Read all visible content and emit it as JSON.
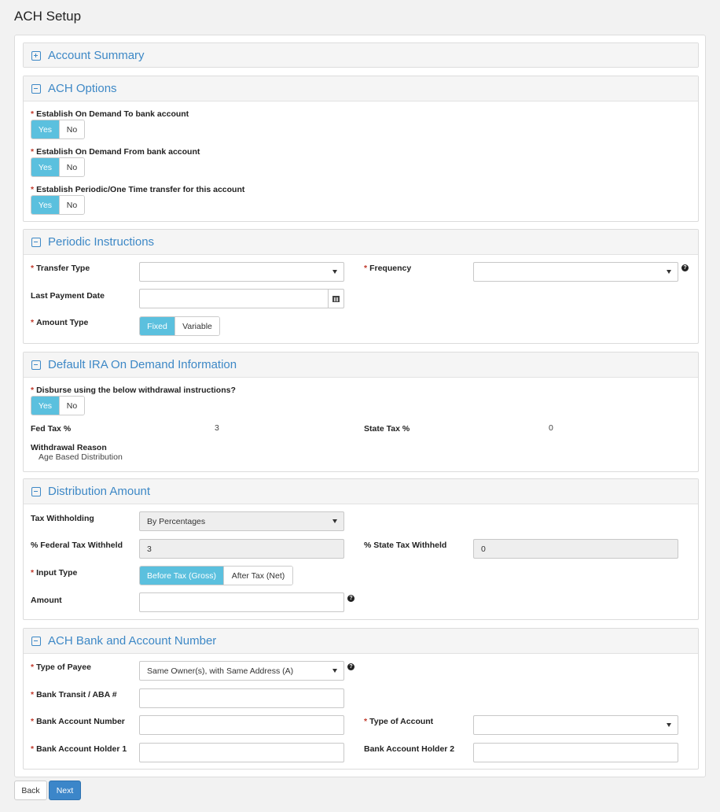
{
  "page_title": "ACH Setup",
  "colors": {
    "accent": "#3d88c6",
    "toggle_active": "#5bc0de",
    "required": "#c0392b",
    "primary_button": "#3c86c9"
  },
  "account_summary": {
    "title": "Account Summary",
    "icon": "plus-square-icon"
  },
  "ach_options": {
    "title": "ACH Options",
    "icon": "minus-square-icon",
    "q1": {
      "label": "Establish On Demand To bank account",
      "yes": "Yes",
      "no": "No",
      "selected": "Yes"
    },
    "q2": {
      "label": "Establish On Demand From bank account",
      "yes": "Yes",
      "no": "No",
      "selected": "Yes"
    },
    "q3": {
      "label": "Establish Periodic/One Time transfer for this account",
      "yes": "Yes",
      "no": "No",
      "selected": "Yes"
    }
  },
  "periodic": {
    "title": "Periodic Instructions",
    "transfer_type_label": "Transfer Type",
    "transfer_type_value": "",
    "frequency_label": "Frequency",
    "frequency_value": "",
    "last_payment_label": "Last Payment Date",
    "last_payment_value": "",
    "amount_type_label": "Amount Type",
    "amount_type_fixed": "Fixed",
    "amount_type_variable": "Variable",
    "amount_type_selected": "Fixed"
  },
  "ira": {
    "title": "Default IRA On Demand Information",
    "disburse_label": "Disburse using the below withdrawal instructions?",
    "yes": "Yes",
    "no": "No",
    "selected": "Yes",
    "fed_tax_label": "Fed Tax %",
    "fed_tax_value": "3",
    "state_tax_label": "State Tax %",
    "state_tax_value": "0",
    "withdrawal_reason_label": "Withdrawal Reason",
    "withdrawal_reason_value": "Age Based Distribution"
  },
  "distribution": {
    "title": "Distribution Amount",
    "tax_withholding_label": "Tax Withholding",
    "tax_withholding_value": "By Percentages",
    "fed_withheld_label": "% Federal Tax Withheld",
    "fed_withheld_value": "3",
    "state_withheld_label": "% State Tax Withheld",
    "state_withheld_value": "0",
    "input_type_label": "Input Type",
    "input_type_before": "Before Tax (Gross)",
    "input_type_after": "After Tax (Net)",
    "input_type_selected": "Before Tax (Gross)",
    "amount_label": "Amount",
    "amount_value": ""
  },
  "bank": {
    "title": "ACH Bank and Account Number",
    "payee_type_label": "Type of Payee",
    "payee_type_value": "Same Owner(s), with Same Address (A)",
    "transit_label": "Bank Transit / ABA #",
    "transit_value": "",
    "account_number_label": "Bank Account Number",
    "account_number_value": "",
    "account_type_label": "Type of Account",
    "account_type_value": "",
    "holder1_label": "Bank Account Holder 1",
    "holder1_value": "",
    "holder2_label": "Bank Account Holder 2",
    "holder2_value": ""
  },
  "footer": {
    "back": "Back",
    "next": "Next"
  }
}
